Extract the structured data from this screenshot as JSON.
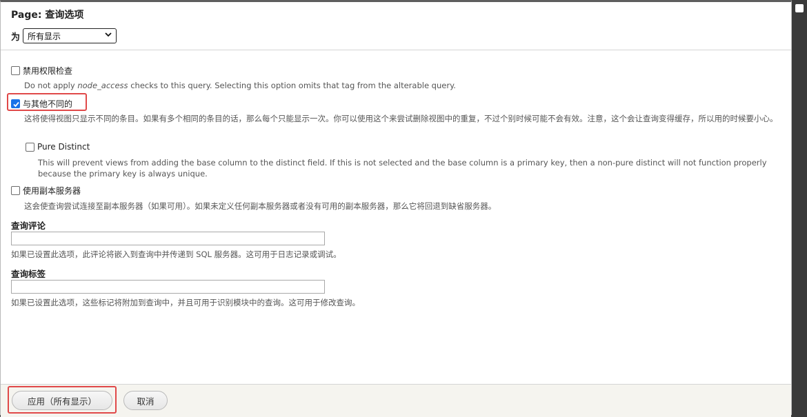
{
  "header": {
    "title": "Page: 查询选项",
    "for_label": "为",
    "display_select": {
      "value": "所有显示"
    }
  },
  "options": {
    "disable_access": {
      "label": "禁用权限检查",
      "checked": false,
      "desc_pre": "Do not apply ",
      "desc_code": "node_access",
      "desc_post": " checks to this query. Selecting this option omits that tag from the alterable query."
    },
    "distinct": {
      "label": "与其他不同的",
      "checked": true,
      "desc": "这将使得视图只显示不同的条目。如果有多个相同的条目的话，那么每个只能显示一次。你可以使用这个来尝试删除视图中的重复，不过个别时候可能不会有效。注意，这个会让查询变得缓存，所以用的时候要小心。"
    },
    "pure_distinct": {
      "label": "Pure Distinct",
      "checked": false,
      "desc": "This will prevent views from adding the base column to the distinct field. If this is not selected and the base column is a primary key, then a non-pure distinct will not function properly because the primary key is always unique."
    },
    "replica": {
      "label": "使用副本服务器",
      "checked": false,
      "desc": "这会使查询尝试连接至副本服务器（如果可用）。如果未定义任何副本服务器或者没有可用的副本服务器，那么它将回退到缺省服务器。"
    }
  },
  "query_comment": {
    "label": "查询评论",
    "value": "",
    "desc": "如果已设置此选项，此评论将嵌入到查询中并传递到 SQL 服务器。这可用于日志记录或调试。"
  },
  "query_tags": {
    "label": "查询标签",
    "value": "",
    "desc": "如果已设置此选项，这些标记将附加到查询中，并且可用于识别模块中的查询。这可用于修改查询。"
  },
  "footer": {
    "apply_label": "应用（所有显示）",
    "cancel_label": "取消"
  },
  "colors": {
    "highlight": "#e04848",
    "checkbox_checked": "#1a73e8"
  }
}
